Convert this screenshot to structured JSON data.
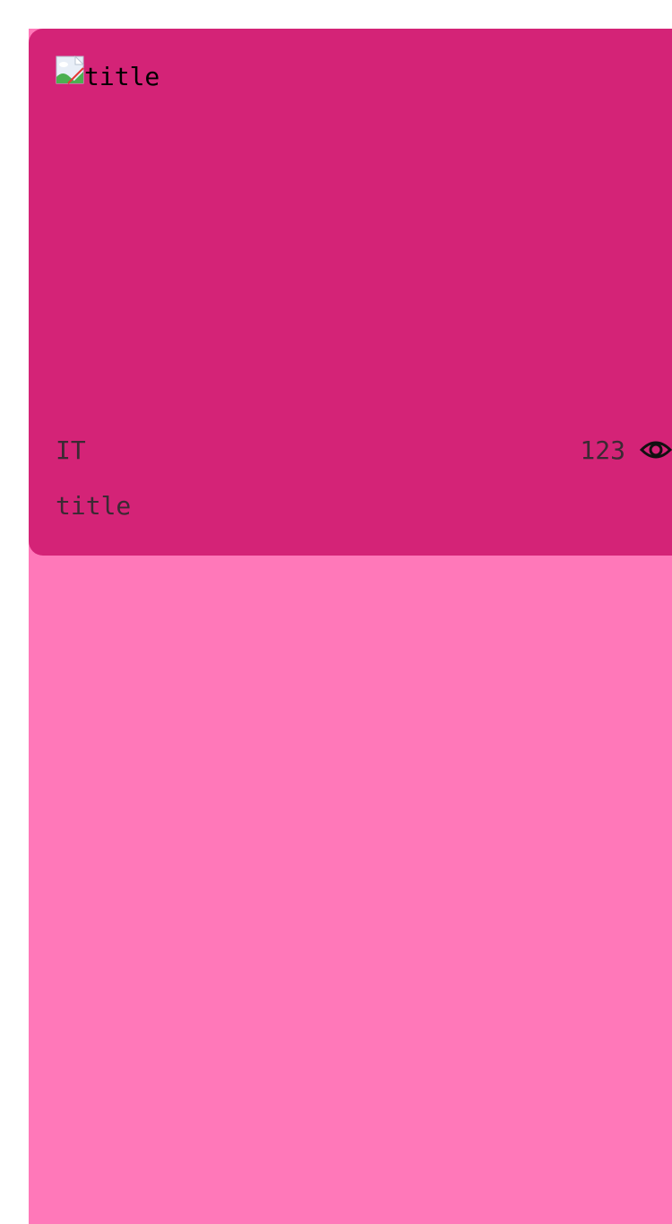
{
  "card": {
    "image_alt": "title",
    "category": "IT",
    "views": "123",
    "title": "title",
    "icons": {
      "image": "broken-image-icon",
      "views": "eye-icon"
    }
  },
  "colors": {
    "page_background": "#ff78b9",
    "card_background": "#d42377",
    "text": "#3a2a33"
  }
}
